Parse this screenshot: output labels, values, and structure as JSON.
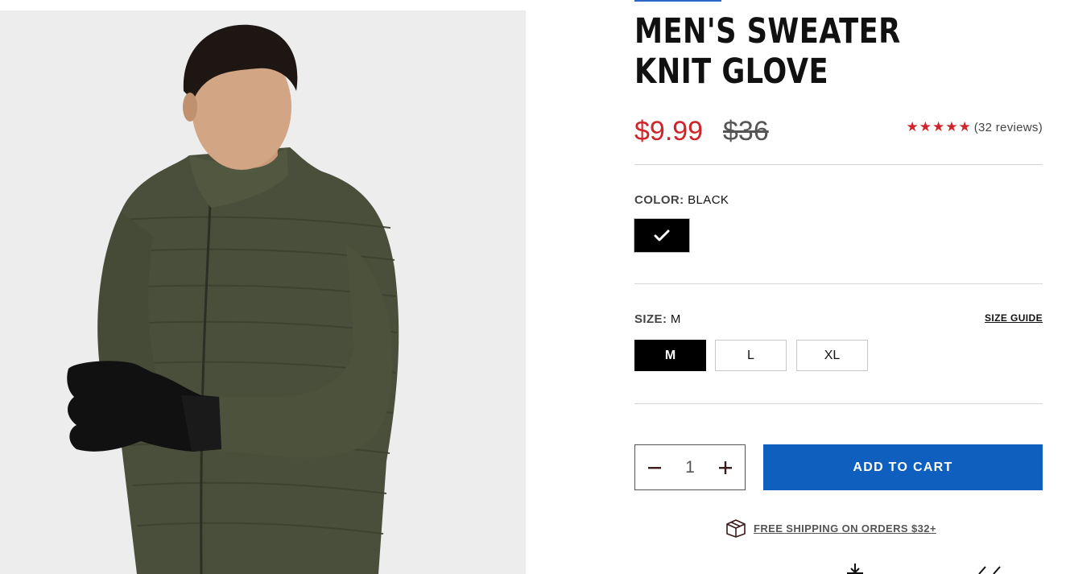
{
  "product": {
    "title": "MEN'S SWEATER KNIT GLOVE",
    "price_sale": "$9.99",
    "price_original": "$36",
    "rating": {
      "stars": 5,
      "reviews_text": "(32 reviews)"
    }
  },
  "color": {
    "label": "COLOR:",
    "selected": "BLACK",
    "swatches": [
      {
        "name": "Black",
        "hex": "#000000",
        "selected": true
      }
    ]
  },
  "size": {
    "label": "SIZE:",
    "selected": "M",
    "guide_label": "SIZE GUIDE",
    "options": [
      "M",
      "L",
      "XL"
    ]
  },
  "cart": {
    "quantity": "1",
    "add_label": "ADD TO CART"
  },
  "shipping": {
    "text": "FREE SHIPPING ON ORDERS $32+"
  },
  "colors": {
    "sale_red": "#d0242a",
    "cart_blue": "#0f5fbf",
    "image_bg": "#ededed",
    "jacket_olive": "#4a4f3b"
  },
  "icons": [
    "check-icon",
    "minus-icon",
    "plus-icon",
    "box-icon",
    "star-icon"
  ]
}
